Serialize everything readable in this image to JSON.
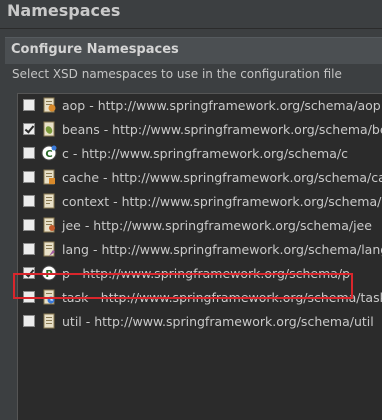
{
  "window": {
    "title": "Namespaces"
  },
  "section": {
    "title": "Configure Namespaces",
    "description": "Select XSD namespaces to use in the configuration file"
  },
  "namespaces": [
    {
      "label": "aop - http://www.springframework.org/schema/aop",
      "checked": false,
      "icon": "aop-icon"
    },
    {
      "label": "beans - http://www.springframework.org/schema/beans",
      "checked": true,
      "icon": "beans-icon"
    },
    {
      "label": "c - http://www.springframework.org/schema/c",
      "checked": false,
      "icon": "c-icon"
    },
    {
      "label": "cache - http://www.springframework.org/schema/cache",
      "checked": false,
      "icon": "cache-icon"
    },
    {
      "label": "context - http://www.springframework.org/schema/context",
      "checked": false,
      "icon": "context-icon"
    },
    {
      "label": "jee - http://www.springframework.org/schema/jee",
      "checked": false,
      "icon": "jee-icon"
    },
    {
      "label": "lang - http://www.springframework.org/schema/lang",
      "checked": false,
      "icon": "lang-icon"
    },
    {
      "label": "p - http://www.springframework.org/schema/p",
      "checked": true,
      "icon": "p-icon"
    },
    {
      "label": "task - http://www.springframework.org/schema/task",
      "checked": false,
      "icon": "task-icon"
    },
    {
      "label": "util - http://www.springframework.org/schema/util",
      "checked": false,
      "icon": "util-icon"
    }
  ],
  "highlight_color": "#d9262c"
}
